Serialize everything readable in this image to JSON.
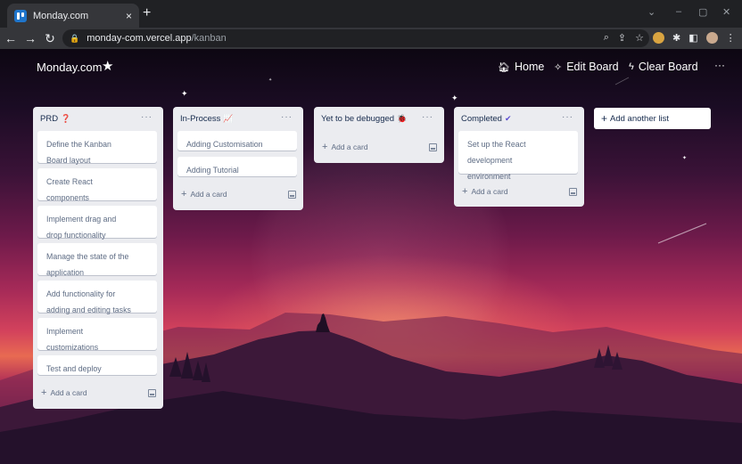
{
  "browser": {
    "tab_title": "Monday.com",
    "tab_close": "×",
    "new_tab": "+",
    "url_host": "monday-com.vercel.app",
    "url_path": "/kanban",
    "window_controls": [
      "⌄",
      "–",
      "▢",
      "✕"
    ]
  },
  "nav": {
    "brand": "Monday.com",
    "home_label": "Home",
    "edit_board_label": "Edit Board",
    "clear_board_label": "Clear Board",
    "more": "···"
  },
  "lists": [
    {
      "title": "PRD",
      "emoji": "❓",
      "emoji_color": "#e5383b",
      "cards": [
        "Define the Kanban\nBoard layout",
        "Create React\ncomponents",
        "Implement drag and\ndrop functionality",
        "Manage the state of the\napplication",
        "Add functionality for\nadding and editing tasks",
        "Implement\ncustomizations",
        "Test and deploy"
      ],
      "add_card_label": "Add a card"
    },
    {
      "title": "In-Process",
      "emoji": "📈",
      "emoji_color": "#d85aa8",
      "cards": [
        "Adding Customisation",
        "Adding Tutorial"
      ],
      "add_card_label": "Add a card"
    },
    {
      "title": "Yet to be debugged",
      "emoji": "🐞",
      "emoji_color": "#2e9a3f",
      "cards": [],
      "add_card_label": "Add a card"
    },
    {
      "title": "Completed",
      "emoji": "✔",
      "emoji_color": "#5a4bd1",
      "cards": [
        "Set up the React\ndevelopment\nenvironment"
      ],
      "add_card_label": "Add a card"
    }
  ],
  "add_list_label": "Add another list",
  "list_more": "···",
  "add_icon": "+"
}
